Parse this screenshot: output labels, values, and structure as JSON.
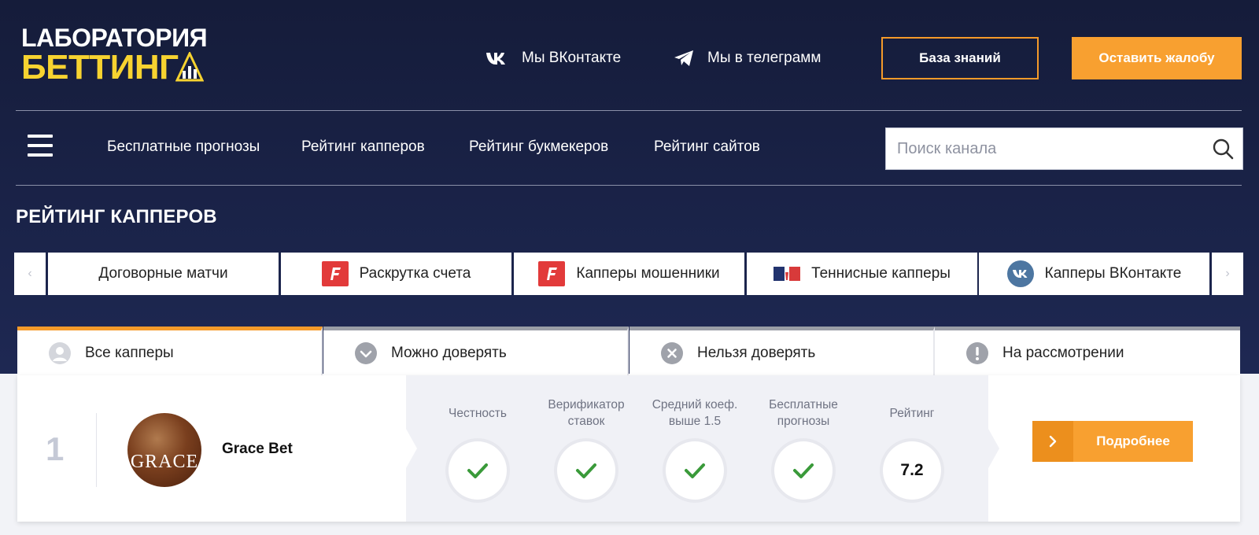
{
  "brand": {
    "line1": "LАБОРАТОРИЯ",
    "line2": "БЕТТИНГ"
  },
  "header": {
    "social_vk": "Мы ВКонтакте",
    "social_tg": "Мы в телеграмм",
    "knowledge_base": "База знаний",
    "complaint": "Оставить жалобу"
  },
  "nav": {
    "items": [
      {
        "label": "Бесплатные прогнозы"
      },
      {
        "label": "Рейтинг капперов"
      },
      {
        "label": "Рейтинг букмекеров"
      },
      {
        "label": "Рейтинг сайтов"
      }
    ],
    "search_placeholder": "Поиск канала"
  },
  "page_title": "РЕЙТИНГ КАППЕРОВ",
  "categories": {
    "prev": "‹",
    "next": "›",
    "items": [
      {
        "label": "Договорные матчи",
        "icon": "none"
      },
      {
        "label": "Раскрутка счета",
        "icon": "fonbet-icon"
      },
      {
        "label": "Капперы мошенники",
        "icon": "fonbet-icon"
      },
      {
        "label": "Теннисные капперы",
        "icon": "tennis-flag-icon"
      },
      {
        "label": "Капперы ВКонтакте",
        "icon": "vk-icon"
      }
    ]
  },
  "filters": [
    {
      "label": "Все капперы",
      "icon": "user-icon",
      "active": true
    },
    {
      "label": "Можно доверять",
      "icon": "check-circle-icon",
      "active": false
    },
    {
      "label": "Нельзя доверять",
      "icon": "cross-circle-icon",
      "active": false
    },
    {
      "label": "На рассмотрении",
      "icon": "exclamation-circle-icon",
      "active": false
    }
  ],
  "cappers": [
    {
      "rank": "1",
      "name": "Grace Bet",
      "avatar_text": "GRACE",
      "metrics": [
        {
          "label": "Честность",
          "value": "check"
        },
        {
          "label": "Верификатор ставок",
          "value": "check"
        },
        {
          "label": "Средний коеф. выше 1.5",
          "value": "check"
        },
        {
          "label": "Бесплатные прогнозы",
          "value": "check"
        },
        {
          "label": "Рейтинг",
          "value": "7.2"
        }
      ],
      "details_label": "Подробнее"
    }
  ],
  "colors": {
    "accent": "#f8a030",
    "header_bg": "#1b2449",
    "logo_yellow": "#f7d330",
    "check_green": "#3a9a3a"
  }
}
